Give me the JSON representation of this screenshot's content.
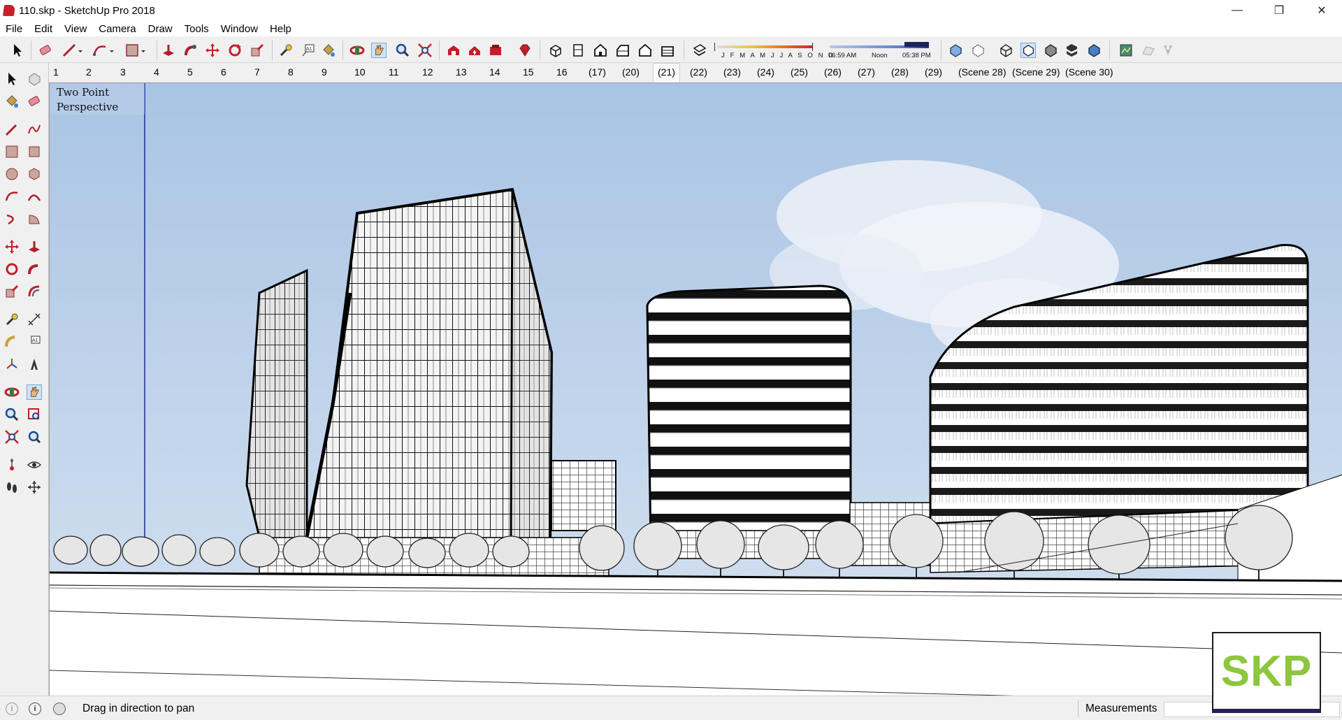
{
  "window": {
    "title": "110.skp - SketchUp Pro 2018",
    "minimize_glyph": "—",
    "maximize_glyph": "❐",
    "close_glyph": "✕"
  },
  "menu": [
    "File",
    "Edit",
    "View",
    "Camera",
    "Draw",
    "Tools",
    "Window",
    "Help"
  ],
  "shadow": {
    "months_label": "J F M A M J J A S O N D",
    "time_start": "06:59 AM",
    "time_mid": "Noon",
    "time_end": "05:38 PM"
  },
  "scenes": [
    "1",
    "2",
    "3",
    "4",
    "5",
    "6",
    "7",
    "8",
    "9",
    "10",
    "11",
    "12",
    "13",
    "14",
    "15",
    "16",
    "(17)",
    "(20)",
    "(21)",
    "(22)",
    "(23)",
    "(24)",
    "(25)",
    "(26)",
    "(27)",
    "(28)",
    "(29)",
    "(Scene 28)",
    "(Scene 29)",
    "(Scene 30)"
  ],
  "active_scene": "(21)",
  "viewport": {
    "camera_label": "Two Point\nPerspective"
  },
  "status": {
    "message": "Drag in direction to pan",
    "measurements_label": "Measurements",
    "measurements_value": ""
  },
  "watermark": {
    "text": "SKP"
  },
  "colors": {
    "sky_top": "#a9c4e4",
    "sky_bottom": "#d7e3f1",
    "skp_green": "#8dc63f",
    "sketchup_red": "#c8202a"
  }
}
